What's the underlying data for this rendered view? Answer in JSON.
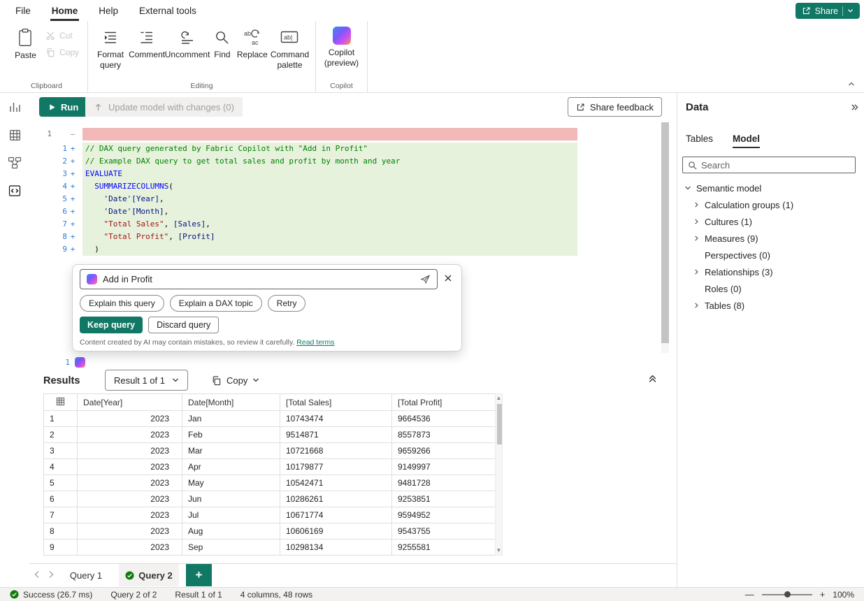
{
  "colors": {
    "accent": "#117865",
    "success": "#107C10",
    "diff_added_bg": "#e7f2dd",
    "diff_removed_bg": "#f2b8b8"
  },
  "menubar": {
    "items": [
      "File",
      "Home",
      "Help",
      "External tools"
    ],
    "share": "Share"
  },
  "ribbon": {
    "clipboard": {
      "label": "Clipboard",
      "paste": "Paste",
      "cut": "Cut",
      "copy": "Copy"
    },
    "editing": {
      "label": "Editing",
      "format_query": "Format query",
      "comment": "Comment",
      "uncomment": "Uncomment",
      "find": "Find",
      "replace": "Replace",
      "command_palette": "Command palette"
    },
    "copilot": {
      "label": "Copilot",
      "button_line1": "Copilot",
      "button_line2": "(preview)"
    }
  },
  "toolbar": {
    "run": "Run",
    "update_model": "Update model with changes (0)",
    "share_feedback": "Share feedback"
  },
  "editor": {
    "removed": {
      "num": "1",
      "marker": "—"
    },
    "pending_num": "1",
    "lines": [
      {
        "num": "1",
        "marker": "+",
        "tokens": [
          {
            "c": "cmt",
            "t": "// DAX query generated by Fabric Copilot with \"Add in Profit\""
          }
        ]
      },
      {
        "num": "2",
        "marker": "+",
        "tokens": [
          {
            "c": "cmt",
            "t": "// Example DAX query to get total sales and profit by month and year"
          }
        ]
      },
      {
        "num": "3",
        "marker": "+",
        "tokens": [
          {
            "c": "kw",
            "t": "EVALUATE"
          }
        ]
      },
      {
        "num": "4",
        "marker": "+",
        "tokens": [
          {
            "c": "pl",
            "t": "  "
          },
          {
            "c": "fn",
            "t": "SUMMARIZECOLUMNS"
          },
          {
            "c": "pl",
            "t": "("
          }
        ]
      },
      {
        "num": "5",
        "marker": "+",
        "tokens": [
          {
            "c": "pl",
            "t": "    "
          },
          {
            "c": "ref",
            "t": "'Date'[Year]"
          },
          {
            "c": "pl",
            "t": ","
          }
        ]
      },
      {
        "num": "6",
        "marker": "+",
        "tokens": [
          {
            "c": "pl",
            "t": "    "
          },
          {
            "c": "ref",
            "t": "'Date'[Month]"
          },
          {
            "c": "pl",
            "t": ","
          }
        ]
      },
      {
        "num": "7",
        "marker": "+",
        "tokens": [
          {
            "c": "pl",
            "t": "    "
          },
          {
            "c": "str",
            "t": "\"Total Sales\""
          },
          {
            "c": "pl",
            "t": ", "
          },
          {
            "c": "ref",
            "t": "[Sales]"
          },
          {
            "c": "pl",
            "t": ","
          }
        ]
      },
      {
        "num": "8",
        "marker": "+",
        "tokens": [
          {
            "c": "pl",
            "t": "    "
          },
          {
            "c": "str",
            "t": "\"Total Profit\""
          },
          {
            "c": "pl",
            "t": ", "
          },
          {
            "c": "ref",
            "t": "[Profit]"
          }
        ]
      },
      {
        "num": "9",
        "marker": "+",
        "tokens": [
          {
            "c": "pl",
            "t": "  )"
          }
        ]
      }
    ]
  },
  "copilot": {
    "prompt": "Add in Profit",
    "chips": [
      "Explain this query",
      "Explain a DAX topic",
      "Retry"
    ],
    "keep": "Keep query",
    "discard": "Discard query",
    "disclaimer": "Content created by AI may contain mistakes, so review it carefully.",
    "read_terms": "Read terms"
  },
  "results": {
    "title": "Results",
    "selector": "Result 1 of 1",
    "copy": "Copy",
    "columns": [
      "Date[Year]",
      "Date[Month]",
      "[Total Sales]",
      "[Total Profit]"
    ],
    "rows": [
      [
        "1",
        "2023",
        "Jan",
        "10743474",
        "9664536"
      ],
      [
        "2",
        "2023",
        "Feb",
        "9514871",
        "8557873"
      ],
      [
        "3",
        "2023",
        "Mar",
        "10721668",
        "9659266"
      ],
      [
        "4",
        "2023",
        "Apr",
        "10179877",
        "9149997"
      ],
      [
        "5",
        "2023",
        "May",
        "10542471",
        "9481728"
      ],
      [
        "6",
        "2023",
        "Jun",
        "10286261",
        "9253851"
      ],
      [
        "7",
        "2023",
        "Jul",
        "10671774",
        "9594952"
      ],
      [
        "8",
        "2023",
        "Aug",
        "10606169",
        "9543755"
      ],
      [
        "9",
        "2023",
        "Sep",
        "10298134",
        "9255581"
      ]
    ]
  },
  "querytabs": {
    "tabs": [
      "Query 1",
      "Query 2"
    ]
  },
  "statusbar": {
    "success": "Success (26.7 ms)",
    "query_count": "Query 2 of 2",
    "result_count": "Result 1 of 1",
    "shape": "4 columns, 48 rows",
    "zoom": "100%"
  },
  "datapane": {
    "title": "Data",
    "tabs": [
      "Tables",
      "Model"
    ],
    "search_placeholder": "Search",
    "root": "Semantic model",
    "items": [
      {
        "label": "Calculation groups (1)"
      },
      {
        "label": "Cultures (1)"
      },
      {
        "label": "Measures (9)"
      },
      {
        "label": "Perspectives (0)"
      },
      {
        "label": "Relationships (3)"
      },
      {
        "label": "Roles (0)"
      },
      {
        "label": "Tables (8)"
      }
    ]
  }
}
